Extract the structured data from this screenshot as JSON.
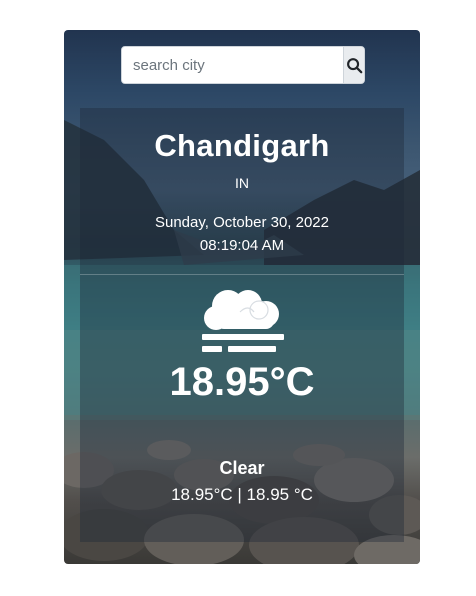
{
  "search": {
    "placeholder": "search city",
    "button_icon": "search-icon"
  },
  "location": {
    "city": "Chandigarh",
    "country": "IN"
  },
  "datetime": {
    "date": "Sunday, October 30, 2022",
    "time": "08:19:04 AM"
  },
  "weather": {
    "icon": "fog-cloud-icon",
    "temperature": "18.95°C",
    "condition": "Clear",
    "min_max": "18.95°C | 18.95 °C"
  },
  "colors": {
    "panel_overlay": "rgba(30,40,55,0.38)",
    "text": "#ffffff",
    "search_button_bg": "#e9ecef"
  }
}
